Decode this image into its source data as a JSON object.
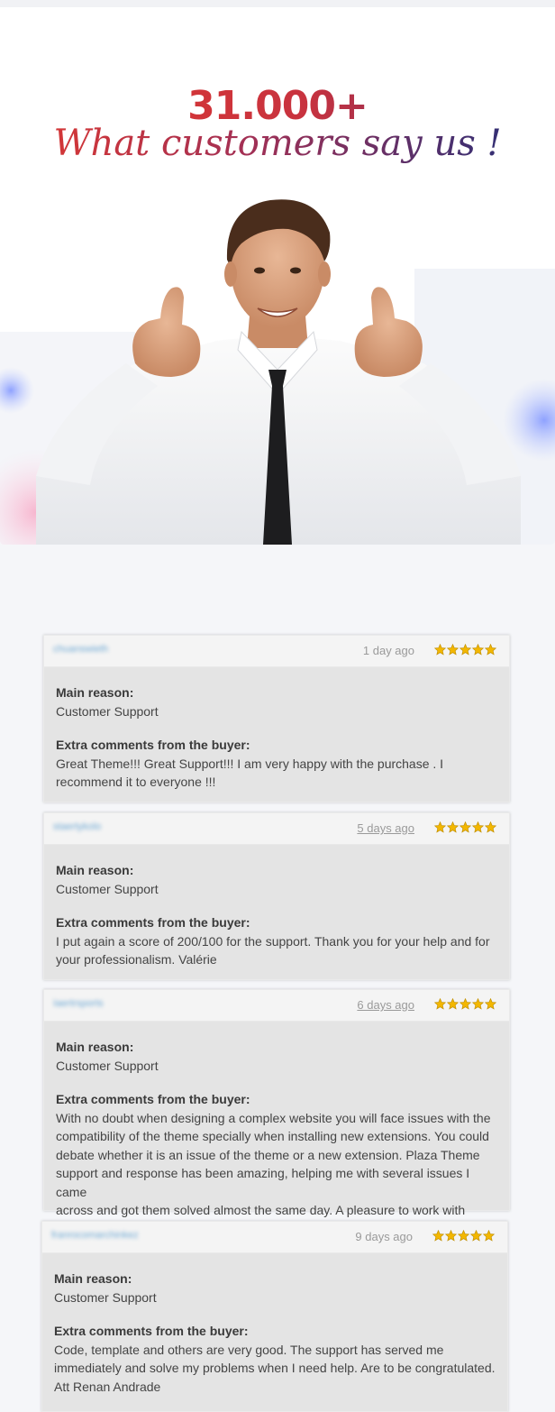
{
  "hero": {
    "count": "31.000+",
    "tagline": "What customers say us !"
  },
  "colors": {
    "accent_red": "#e0382f",
    "accent_navy": "#1d2f7a",
    "star": "#f3b700",
    "username_blur": "#6fa9d4"
  },
  "reviews": [
    {
      "username": "chuanswieth",
      "date": "1 day ago",
      "rating": 5,
      "reason_label": "Main reason:",
      "reason": "Customer Support",
      "comment_label": "Extra comments from the buyer:",
      "comment_lines": [
        "Great Theme!!! Great Support!!! I am very happy with the purchase . I",
        "recommend it to everyone !!!"
      ]
    },
    {
      "username": "staertykolo",
      "date": "5 days ago",
      "rating": 5,
      "reason_label": "Main reason:",
      "reason": "Customer Support",
      "comment_label": "Extra comments from the buyer:",
      "comment_lines": [
        "I put again a score of 200/100 for the support. Thank you for your help and for",
        "your professionalism. Valérie"
      ]
    },
    {
      "username": "Iaertrsports",
      "date": "6 days ago",
      "rating": 5,
      "reason_label": "Main reason:",
      "reason": "Customer Support",
      "comment_label": "Extra comments from the buyer:",
      "comment_lines": [
        "With no doubt when designing a complex website you will face issues with the",
        "compatibility of the theme specially when installing new extensions. You could",
        "debate whether it is an issue of the theme or a new extension. Plaza Theme",
        "support and response has been amazing, helping me with several issues I came",
        "across and got them solved almost the same day. A pleasure to work with them!"
      ]
    },
    {
      "username": "franrocomarchinkez",
      "date": "9 days ago",
      "rating": 5,
      "reason_label": "Main reason:",
      "reason": "Customer Support",
      "comment_label": "Extra comments from the buyer:",
      "comment_lines": [
        "Code, template and others are very good. The support has served me",
        "immediately and solve my problems when I need help. Are to be congratulated.",
        "Att Renan Andrade"
      ]
    }
  ]
}
